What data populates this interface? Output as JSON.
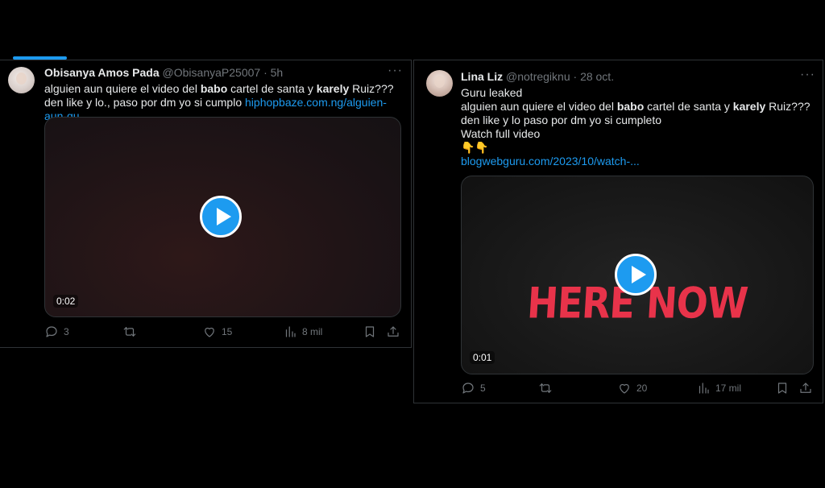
{
  "tweets": [
    {
      "name": "Obisanya Amos Pada",
      "handle": "@ObisanyaP25007",
      "time": "5h",
      "text_parts": [
        "alguien aun quiere el video del ",
        "babo",
        " cartel de santa y ",
        "karely",
        " Ruiz??? den like y lo., paso por dm yo si cumplo "
      ],
      "link": "hiphopbaze.com.ng/alguien-aun-qu...",
      "media": {
        "duration": "0:02"
      },
      "stats": {
        "replies": "3",
        "reposts": "",
        "likes": "15",
        "views": "8 mil"
      }
    },
    {
      "name": "Lina Liz",
      "handle": "@notregiknu",
      "time": "28 oct.",
      "lines": {
        "line1": "Guru leaked",
        "line2_parts": [
          "alguien aun quiere el video del ",
          "babo",
          " cartel de santa y ",
          "karely",
          " Ruiz??? den like y lo paso por dm yo si cumpleto"
        ],
        "line3": "Watch full video",
        "emoji": "👇👇"
      },
      "link": "blogwebguru.com/2023/10/watch-...",
      "media": {
        "duration": "0:01",
        "overlay": "HERE NOW"
      },
      "stats": {
        "replies": "5",
        "reposts": "",
        "likes": "20",
        "views": "17 mil"
      }
    }
  ],
  "colors": {
    "accent": "#1d9bf0",
    "muted": "#71767b",
    "overlay_red": "#e8334a"
  },
  "icons": [
    "more-icon",
    "play-icon",
    "reply-icon",
    "repost-icon",
    "like-icon",
    "views-icon",
    "bookmark-icon",
    "share-icon"
  ]
}
